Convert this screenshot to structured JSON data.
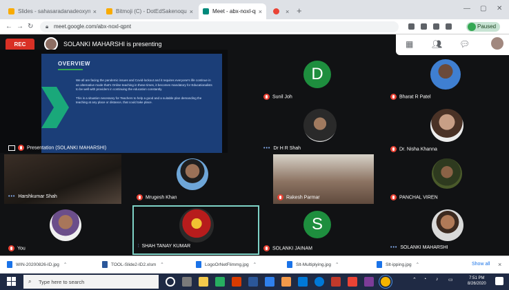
{
  "browser": {
    "tabs": [
      {
        "title": "Slides - sahasaradanadeoxyruat",
        "active": false,
        "color": "#f9ab00"
      },
      {
        "title": "Bitmoji (C) - DotEdSakenoqualr (Dup)",
        "active": false,
        "color": "#f9ab00"
      },
      {
        "title": "Meet - abx-noxl-qpnt",
        "active": true,
        "color": "#00897b"
      },
      {
        "title": "",
        "active": false,
        "color": "#ea4335"
      }
    ],
    "new_tab": "+",
    "url": "meet.google.com/abx-noxl-qpnt",
    "profile_status": "Paused"
  },
  "meet": {
    "rec_label": "REC",
    "presenting_text": "SOLANKI MAHARSHI is presenting",
    "slide": {
      "title": "OVERVIEW",
      "paragraphs": [
        "We all are facing the pandemic issues and Covid-lockout and it requires everyone's life continue in an alternative mode that's Online teaching in these times, it becomes mandatory for Educationalists to be well with providers in continuing the education constantly.",
        "This is a situation necessary for Teachers to help a good and a suitable plan demanding the teaching at any place or distance, that could take place."
      ]
    },
    "participants": [
      {
        "label": "Presentation (SOLANKI MAHARSHI)",
        "indicator": "mic"
      },
      {
        "label": "Sunil Joh",
        "indicator": "mic",
        "initial": "D"
      },
      {
        "label": "Bharat R Patel",
        "indicator": "mic"
      },
      {
        "label": "Dr H R Shah",
        "indicator": "dots"
      },
      {
        "label": "Dr. Nisha Khanna",
        "indicator": "mic"
      },
      {
        "label": "Harshkumar Shah",
        "indicator": "dots"
      },
      {
        "label": "Mrugesh Khan",
        "indicator": "mic"
      },
      {
        "label": "Rakesh Parmar",
        "indicator": "mic"
      },
      {
        "label": "PANCHAL VIREN",
        "indicator": "mic"
      },
      {
        "label": "You",
        "indicator": "mic"
      },
      {
        "label": "SHAH TANAY KUMAR",
        "indicator": "wave"
      },
      {
        "label": "SOLANKI JAINAM",
        "indicator": "mic",
        "initial": "S"
      },
      {
        "label": "SOLANKI MAHARSHI",
        "indicator": "dots"
      }
    ]
  },
  "downloads": {
    "items": [
      {
        "name": "WIN-20200826-ID.jpg",
        "type": "img"
      },
      {
        "name": "TOOL-Slide2-ID2.xlsm",
        "type": "doc"
      },
      {
        "name": "LogoOrNetFlimmg.jpg",
        "type": "img"
      },
      {
        "name": "Slt-Multiplying.jpg",
        "type": "img"
      },
      {
        "name": "Slt-ipping.jpg",
        "type": "img"
      }
    ],
    "show_all": "Show all",
    "close": "×"
  },
  "taskbar": {
    "search_placeholder": "Type here to search",
    "time": "7:51 PM",
    "date": "8/26/2020",
    "app_colors": [
      "#e3e3e3",
      "#7a7a7a",
      "#f2c94c",
      "#27ae60",
      "#2b579a",
      "#d83b01",
      "#2f80ed",
      "#f2994a",
      "#0078d7",
      "#c0392b",
      "#ea4335",
      "#7d3c98",
      "#f4b400"
    ]
  }
}
